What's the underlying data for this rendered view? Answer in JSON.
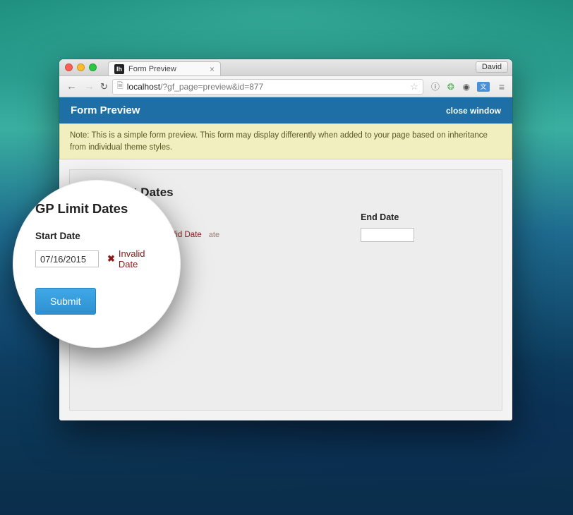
{
  "browser": {
    "tab_title": "Form Preview",
    "user_name": "David",
    "url_host": "localhost",
    "url_path": "/?gf_page=preview&id=877"
  },
  "header": {
    "title": "Form Preview",
    "close_label": "close window"
  },
  "note": "Note: This is a simple form preview. This form may display differently when added to your page based on inheritance from individual theme styles.",
  "form": {
    "title": "GP Limit Dates",
    "start_date": {
      "label": "Start Date",
      "value": "07/16/2015",
      "invalid_label": "Invalid Date",
      "guide_suffix": "ate"
    },
    "end_date": {
      "label": "End Date",
      "value": ""
    },
    "submit_label": "Submit"
  }
}
